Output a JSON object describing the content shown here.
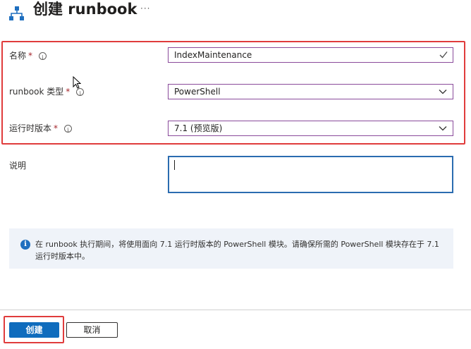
{
  "header": {
    "title": "创建 runbook",
    "more_label": "···"
  },
  "form": {
    "name": {
      "label": "名称",
      "required_mark": "*",
      "value": "IndexMaintenance"
    },
    "type": {
      "label": "runbook 类型",
      "required_mark": "*",
      "value": "PowerShell"
    },
    "runtime": {
      "label": "运行时版本",
      "required_mark": "*",
      "value": "7.1 (预览版)"
    },
    "description": {
      "label": "说明",
      "value": ""
    }
  },
  "banner": {
    "text": "在 runbook 执行期间，将使用面向 7.1 运行时版本的 PowerShell 模块。请确保所需的 PowerShell 模块存在于 7.1 运行时版本中。"
  },
  "footer": {
    "create_label": "创建",
    "cancel_label": "取消"
  },
  "colors": {
    "accent": "#0f6cbd",
    "highlight": "#e03c3c",
    "field_border": "#8a4a9b",
    "info_banner_bg": "#eff3f9"
  },
  "icons": [
    "runbook-logo-icon",
    "more-icon",
    "info-icon",
    "checkmark-icon",
    "chevron-down-icon",
    "mouse-cursor-icon"
  ]
}
